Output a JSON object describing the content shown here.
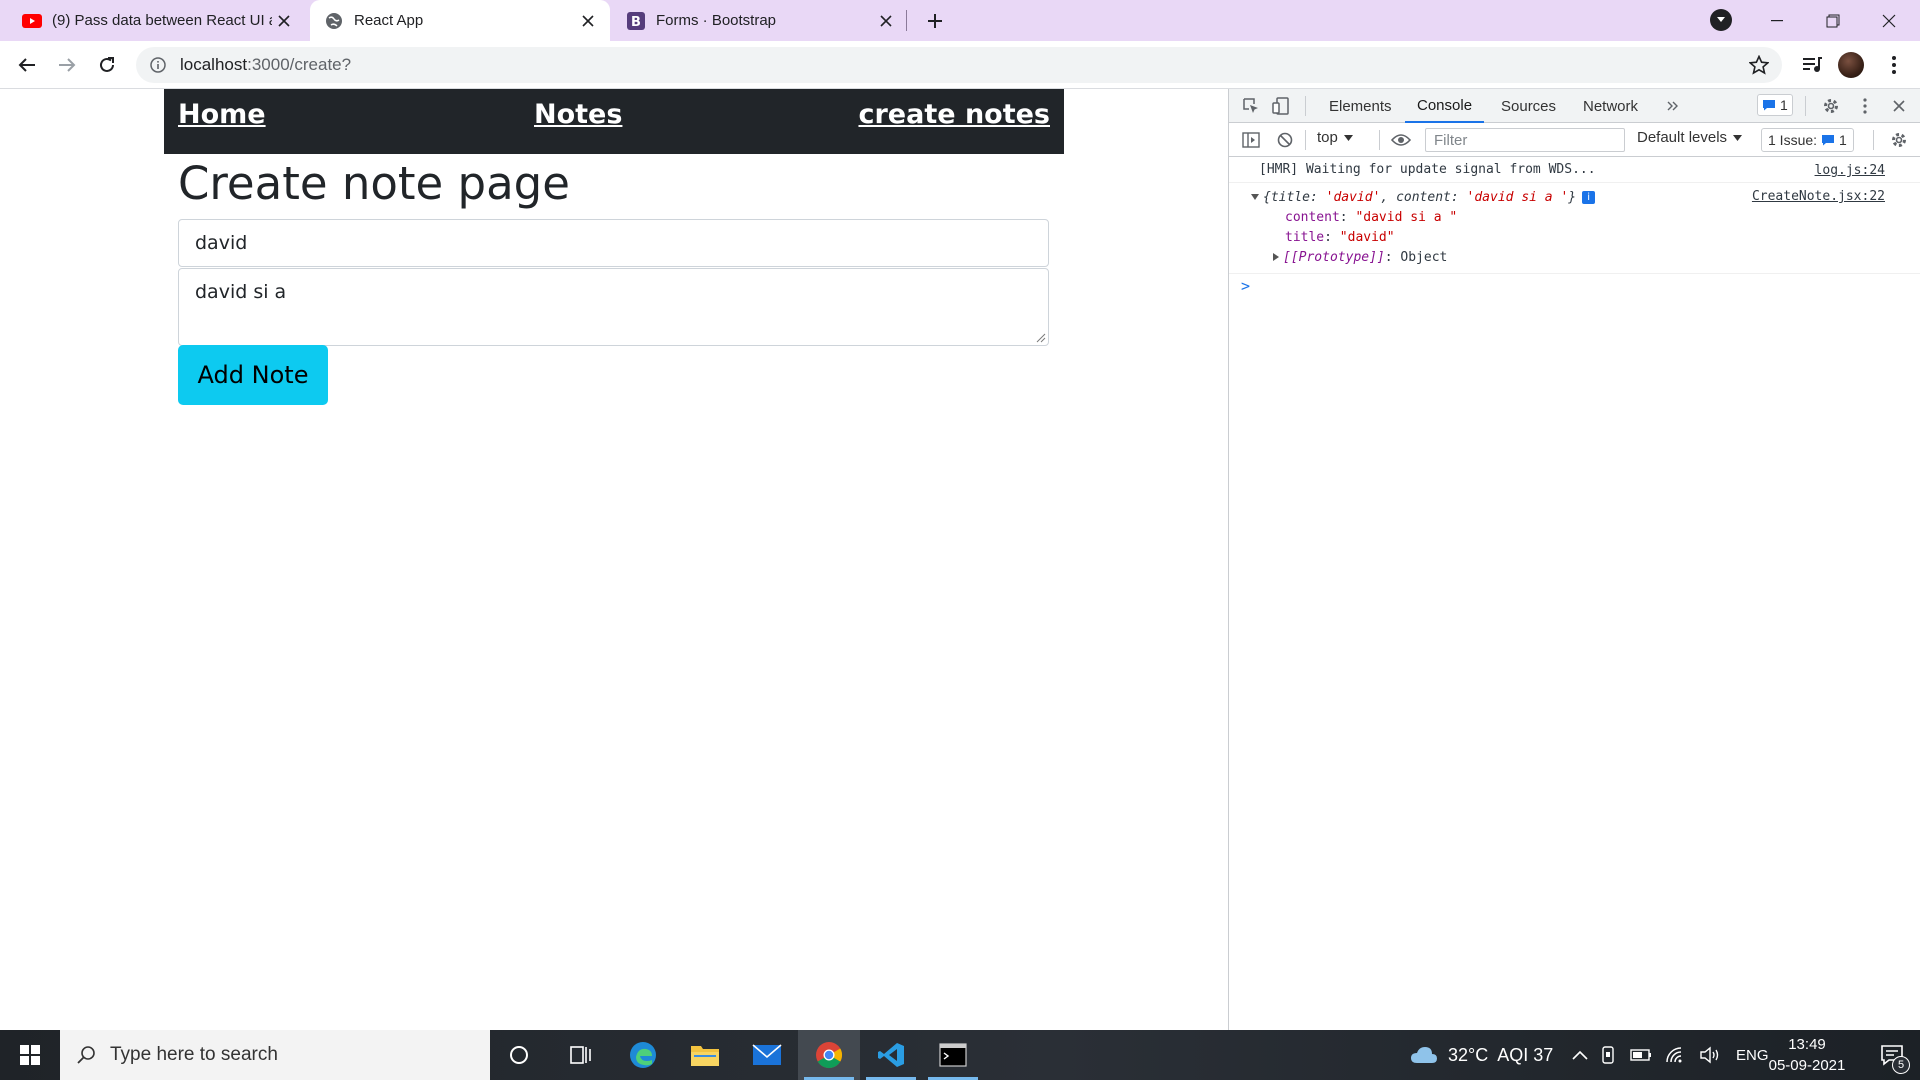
{
  "browser": {
    "tabs": [
      {
        "title": "(9) Pass data between React UI and",
        "favicon": "youtube-icon"
      },
      {
        "title": "React App",
        "favicon": "globe-icon"
      },
      {
        "title": "Forms · Bootstrap",
        "favicon": "bootstrap-icon"
      }
    ],
    "url_host": "localhost",
    "url_path": ":3000/create?"
  },
  "page": {
    "nav": {
      "home": "Home",
      "notes": "Notes",
      "create": "create notes"
    },
    "title": "Create note page",
    "title_field_value": "david",
    "content_field_value": "david si a",
    "add_button": "Add Note",
    "colors": {
      "navbar": "#212529",
      "button": "#0dcaf0"
    }
  },
  "devtools": {
    "tabs": [
      "Elements",
      "Console",
      "Sources",
      "Network"
    ],
    "active_tab": "Console",
    "message_badge": "1",
    "context": "top",
    "filter_placeholder": "Filter",
    "levels": "Default levels",
    "issues_label": "1 Issue:",
    "issues_count": "1",
    "console": {
      "hmr_line": "[HMR] Waiting for update signal from WDS...",
      "hmr_src": "log.js:24",
      "obj_summary_open": "{",
      "obj_k1": "title",
      "obj_v1": "'david'",
      "obj_k2": "content",
      "obj_v2": "'david si a '",
      "obj_summary_close": "}",
      "obj_src": "CreateNote.jsx:22",
      "content_key": "content",
      "content_val": "\"david si a \"",
      "title_key": "title",
      "title_val": "\"david\"",
      "proto_key": "[[Prototype]]",
      "proto_val": "Object",
      "prompt": ">"
    }
  },
  "taskbar": {
    "search_placeholder": "Type here to search",
    "weather": "32°C  AQI 37",
    "lang": "ENG",
    "time": "13:49",
    "date": "05-09-2021",
    "notification_count": "5"
  }
}
